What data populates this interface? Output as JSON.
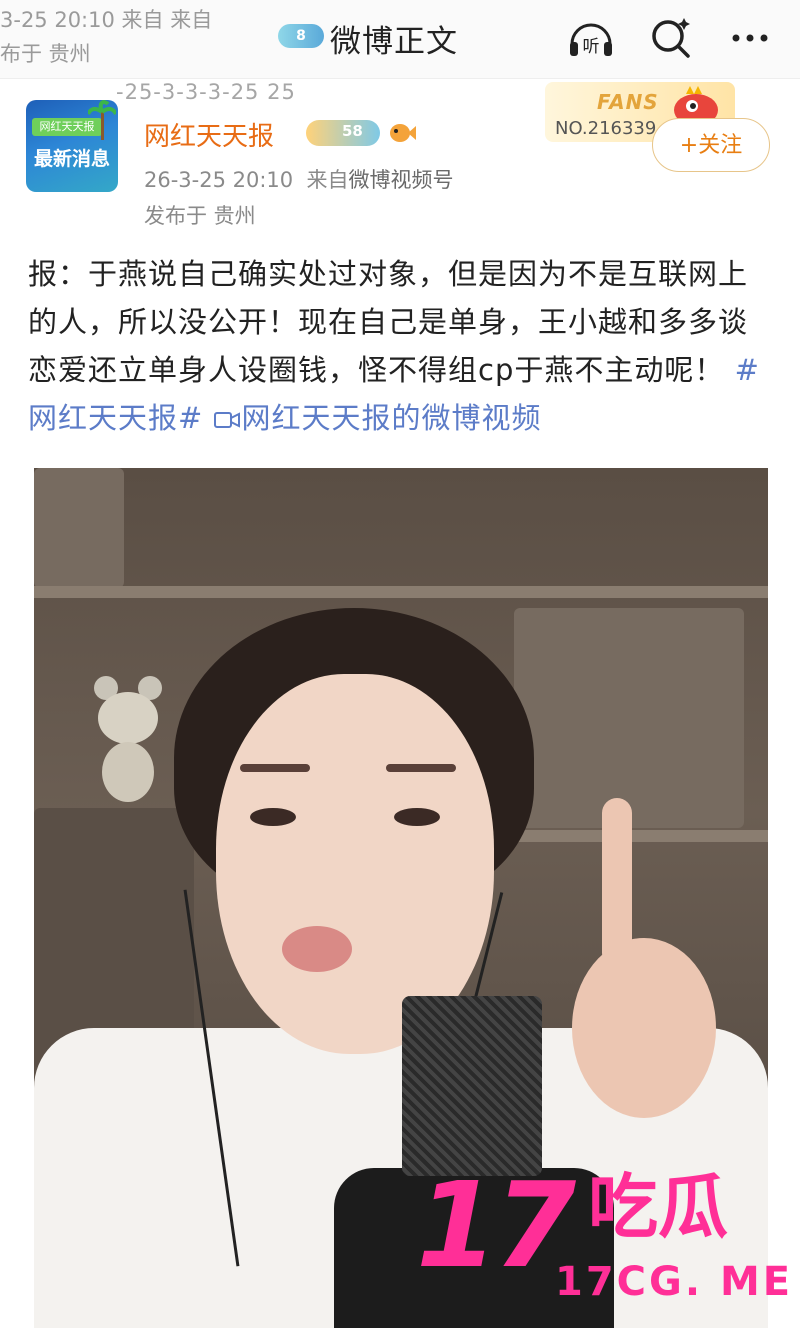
{
  "ghost_header": {
    "line1": "3-25 20:10  来自 来自",
    "line2": "布于 贵州",
    "faded_id": "-25-3-3-3-25 25"
  },
  "nav": {
    "badge": "8",
    "title": "微博正文",
    "listen_label": "听",
    "more_label": "···"
  },
  "author": {
    "avatar_top": "网红天天报",
    "avatar_main": "最新消息",
    "name": "网红天天报",
    "level": "58",
    "time": "26-3-25 20:10",
    "from_prefix": "来自",
    "source": "微博视频号",
    "location": "发布于 贵州"
  },
  "fans": {
    "word": "FANS",
    "number": "NO.216339"
  },
  "follow": {
    "label": "+关注"
  },
  "post": {
    "text": "报：于燕说自己确实处过对象，但是因为不是互联网上的人，所以没公开！现在自己是单身，王小越和多多谈恋爱还立单身人设圈钱，怪不得组cp于燕不主动呢！",
    "hashtag": "#网红天天报#",
    "video_link": "网红天天报的微博视频"
  },
  "watermark": {
    "number": "17",
    "chars": "吃瓜",
    "url": "17CG. ME"
  },
  "colors": {
    "author_name": "#e86c15",
    "hashtag": "#5c7cc8",
    "follow": "#e87e12",
    "watermark": "#ff2f97"
  },
  "icons": [
    "headphones-icon",
    "search-icon",
    "more-icon",
    "fish-icon",
    "fans-bird-icon",
    "video-icon"
  ]
}
